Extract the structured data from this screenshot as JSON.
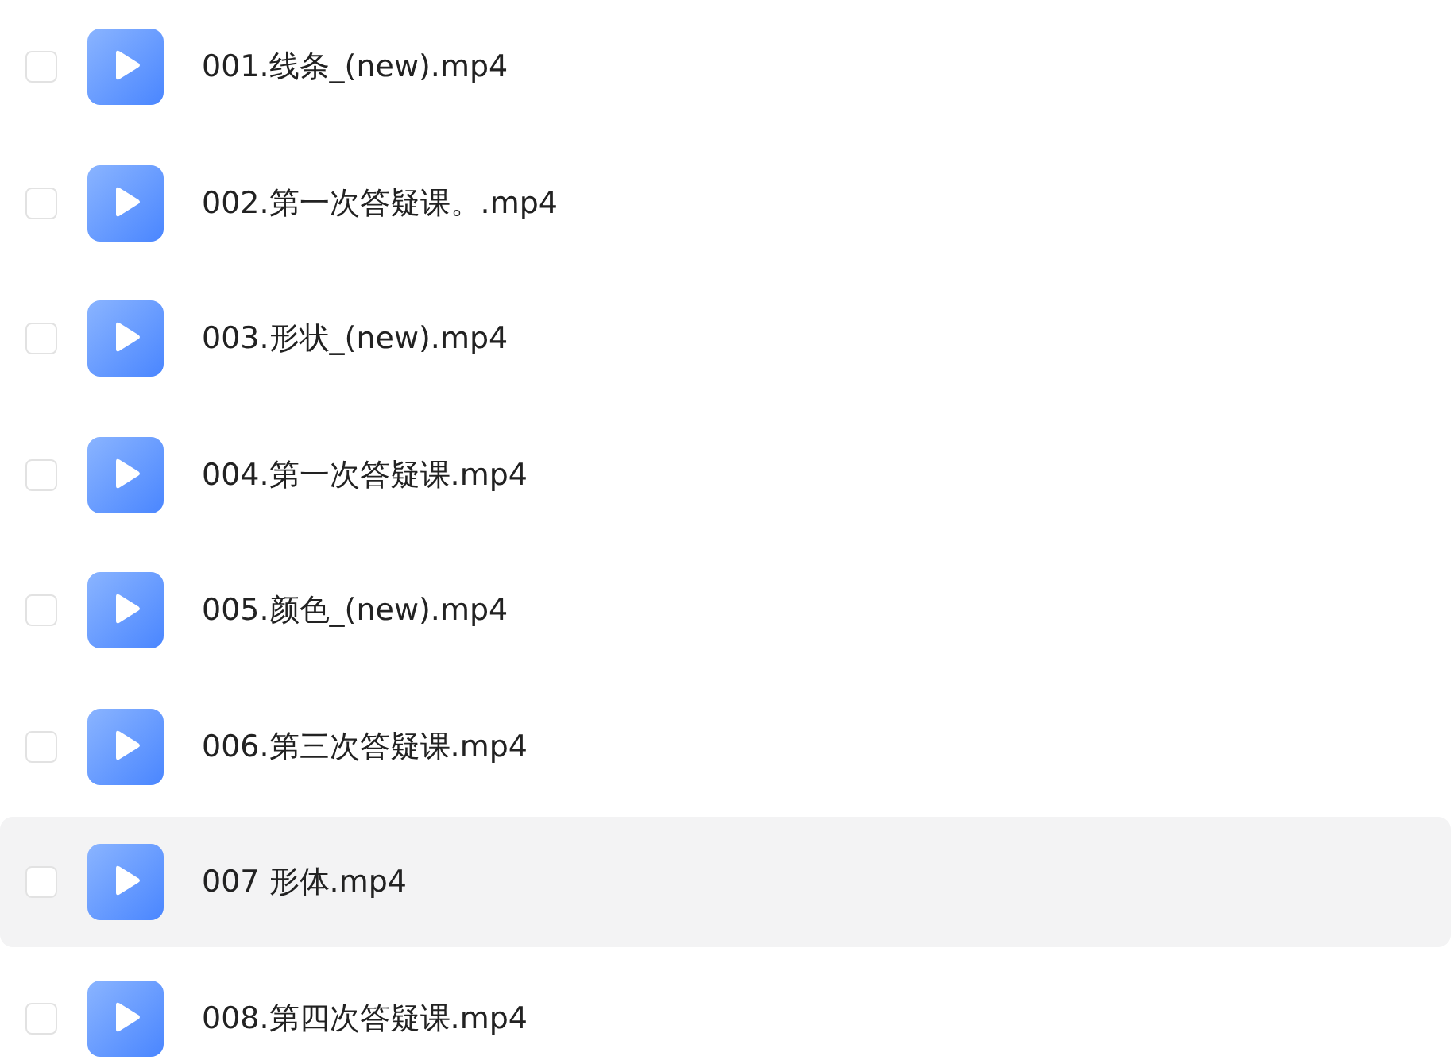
{
  "files": [
    {
      "name": "001.线条_(new).mp4",
      "checked": false,
      "highlighted": false
    },
    {
      "name": "002.第一次答疑课。.mp4",
      "checked": false,
      "highlighted": false
    },
    {
      "name": "003.形状_(new).mp4",
      "checked": false,
      "highlighted": false
    },
    {
      "name": "004.第一次答疑课.mp4",
      "checked": false,
      "highlighted": false
    },
    {
      "name": "005.颜色_(new).mp4",
      "checked": false,
      "highlighted": false
    },
    {
      "name": "006.第三次答疑课.mp4",
      "checked": false,
      "highlighted": false
    },
    {
      "name": "007 形体.mp4",
      "checked": false,
      "highlighted": true
    },
    {
      "name": "008.第四次答疑课.mp4",
      "checked": false,
      "highlighted": false
    }
  ]
}
